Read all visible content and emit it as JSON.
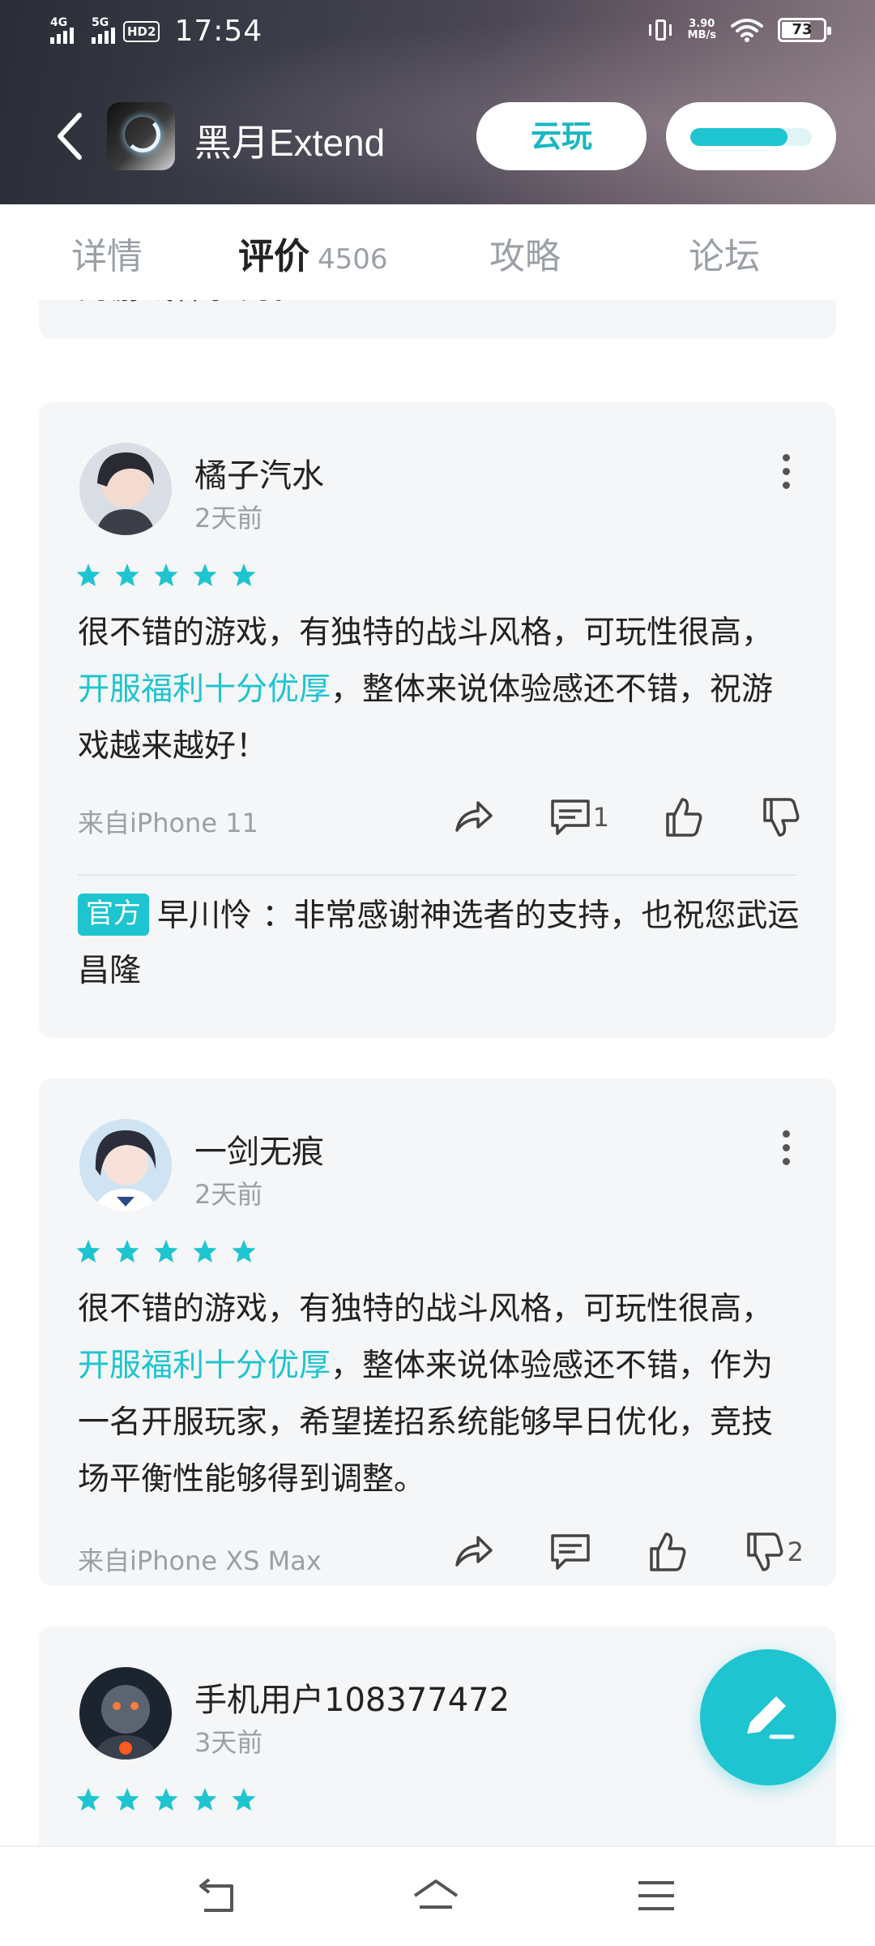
{
  "status_bar": {
    "network_1": "4G",
    "network_2": "5G",
    "hd_label": "HD2",
    "time": "17:54",
    "speed_value": "3.90",
    "speed_unit": "MB/s",
    "battery": "73",
    "battery_level": 0.73
  },
  "header": {
    "game_title": "黑月Extend",
    "cloud_play_label": "云玩",
    "download_progress": 0.8
  },
  "tabs": [
    {
      "label": "详情"
    },
    {
      "label": "评价",
      "count": "4506"
    },
    {
      "label": "攻略"
    },
    {
      "label": "论坛"
    }
  ],
  "partial_review": {
    "tail_text": "的游戏体验的。"
  },
  "reviews": [
    {
      "username": "橘子汽水",
      "time": "2天前",
      "rating": 5,
      "text_before": "很不错的游戏，有独特的战斗风格，可玩性很高，",
      "highlight": "开服福利十分优厚",
      "text_after": "，整体来说体验感还不错，祝游戏越来越好！",
      "device": "来自iPhone  11",
      "comment_count": "1",
      "dislike_count": "",
      "official_badge": "官方",
      "official_reply": "早川怜 ：非常感谢神选者的支持，也祝您武运昌隆"
    },
    {
      "username": "一剑无痕",
      "time": "2天前",
      "rating": 5,
      "text_before": "很不错的游戏，有独特的战斗风格，可玩性很高，",
      "highlight": "开服福利十分优厚",
      "text_after": "，整体来说体验感还不错，作为一名开服玩家，希望搓招系统能够早日优化，竞技场平衡性能够得到调整。",
      "device": "来自iPhone  XS  Max",
      "comment_count": "",
      "dislike_count": "2"
    },
    {
      "username": "手机用户108377472",
      "time": "3天前",
      "rating": 5
    }
  ],
  "colors": {
    "accent": "#1ec4cf",
    "card_bg": "#f4f6f8",
    "muted_text": "#9aa0a6"
  }
}
